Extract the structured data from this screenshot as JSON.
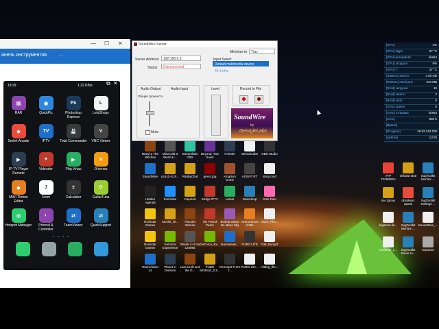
{
  "left_window": {
    "toolbar_label": "анель инструментов",
    "toolbar_dots": "...",
    "minimize": "—",
    "maximize": "☐",
    "close": "✕"
  },
  "phone": {
    "time": "18:29",
    "speed": "1.22 KB/s",
    "apps": [
      {
        "label": "RAR",
        "color": "#8e44ad",
        "glyph": "▤"
      },
      {
        "label": "QuickPic",
        "color": "#2e86de",
        "glyph": "◉"
      },
      {
        "label": "Photoshop Express",
        "color": "#1b3a5c",
        "glyph": "Ps"
      },
      {
        "label": "LetyShops",
        "color": "#f5f5f5",
        "glyph": "L"
      },
      {
        "label": "Smilet Arcade",
        "color": "#e74c3c",
        "glyph": "◈"
      },
      {
        "label": "IPTV",
        "color": "#1e6fc7",
        "glyph": "TV"
      },
      {
        "label": "Total Commander",
        "color": "#3a3a3a",
        "glyph": "💾"
      },
      {
        "label": "VNC Viewer",
        "color": "#444",
        "glyph": "V"
      },
      {
        "label": "IP-TV Player Remote",
        "color": "#2c3e50",
        "glyph": "▶"
      },
      {
        "label": "Videoder",
        "color": "#c0392b",
        "glyph": "▼"
      },
      {
        "label": "Play Игры",
        "color": "#27ae60",
        "glyph": "▶"
      },
      {
        "label": "Очистка",
        "color": "#f39c12",
        "glyph": "✕"
      },
      {
        "label": "MIUI Theme Editor",
        "color": "#e67e22",
        "glyph": "◆"
      },
      {
        "label": "Joom",
        "color": "#fff",
        "glyph": "J"
      },
      {
        "label": "Calculator",
        "color": "#333",
        "glyph": "±"
      },
      {
        "label": "GuitarTuna",
        "color": "#9acd32",
        "glyph": "G"
      },
      {
        "label": "Hotspot Manager",
        "color": "#2ecc71",
        "glyph": "◎"
      },
      {
        "label": "Prismal & Controller",
        "color": "#8e44ad",
        "glyph": "◐"
      },
      {
        "label": "TeamViewer",
        "color": "#1e6fc7",
        "glyph": "⇄"
      },
      {
        "label": "QuickSupport",
        "color": "#2980b9",
        "glyph": "⇄"
      }
    ],
    "dock": [
      {
        "name": "phone-dock-icon",
        "color": "#2ecc71"
      },
      {
        "name": "contacts-dock-icon",
        "color": "#95a5a6"
      },
      {
        "name": "messages-dock-icon",
        "color": "#27ae60"
      },
      {
        "name": "browser-dock-icon",
        "color": "#3498db"
      }
    ]
  },
  "soundwire": {
    "title": "SoundWire Server",
    "minimize_to": "Minimize to",
    "tray": "Tray",
    "server_address_label": "Server Address:",
    "server_address": "192.168.0.3",
    "status_label": "Status:",
    "status": "Disconnected",
    "input_select_label": "Input Select",
    "input_device": "Default multimedia device",
    "sample_rate": "44.1 kHz",
    "audio_output_label": "Audio Output",
    "audio_input_label": "Audio Input",
    "general_volume_label": "Общая громкость",
    "mute_label": "Mute",
    "level_label": "Level",
    "record_label": "Record to File",
    "logo_line1": "SoundWire",
    "logo_line2": "by",
    "logo_line3": "GeorgieLabs"
  },
  "gauges": [
    {
      "label": "[GPU]",
      "value": "4%"
    },
    {
      "label": "[GPU] Ядро",
      "value": "57 °C"
    },
    {
      "label": "[GPU] интерфейс",
      "value": "obs64"
    },
    {
      "label": "[GPU] загрузка",
      "value": "6%"
    },
    {
      "label": "[GPU] Т",
      "value": "37 °C"
    },
    {
      "label": "[Память] занято",
      "value": "4.06 GB"
    },
    {
      "label": "[Память] свободно",
      "value": "510 MB"
    },
    {
      "label": "[RAM] загрузка",
      "value": "10"
    },
    {
      "label": "[RAM] занято",
      "value": "2"
    },
    {
      "label": "[RAM] своб",
      "value": "0"
    },
    {
      "label": "[Сеть] прием",
      "value": "0"
    },
    {
      "label": "[Сеть] отправка",
      "value": "obs64"
    },
    {
      "label": "[Сеть]",
      "value": "685 К"
    },
    {
      "label": "[Время]",
      "value": ""
    },
    {
      "label": "[IP-адрес]",
      "value": "46.53.243.206"
    },
    {
      "label": "[Uptime]",
      "value": "1d 2h"
    }
  ],
  "desktop_icons": [
    {
      "label": "Brawl 3 The Witches Guid...",
      "color": "#8b4513"
    },
    {
      "label": "Minecraft 3 World Li...",
      "color": "#555"
    },
    {
      "label": "Streamlabs OBS",
      "color": "#31c3a2"
    },
    {
      "label": "Beyond: Two Souls",
      "color": "#663399"
    },
    {
      "label": "Fortnite",
      "color": "#2c3e50"
    },
    {
      "label": "StreamLabs",
      "color": "#f0f0f0"
    },
    {
      "label": "OBS Studio",
      "color": "#333"
    },
    {
      "label": "SoundWire",
      "color": "#1e6fc7"
    },
    {
      "label": "pcsx2-v1.5...",
      "color": "#d4a017"
    },
    {
      "label": "RabbyChat",
      "color": "#d4a017"
    },
    {
      "label": "gree1.jpg",
      "color": "#8b0000"
    },
    {
      "label": "Kingdom Come",
      "color": "#a0522d"
    },
    {
      "label": "AGENT RT",
      "color": "#444"
    },
    {
      "label": "temp.cmd",
      "color": "#f0f0f0"
    },
    {
      "label": "Hidden Agenda",
      "color": "#222"
    },
    {
      "label": "freemake",
      "color": "#1e90ff"
    },
    {
      "label": "Caputed",
      "color": "#d4a017"
    },
    {
      "label": "Zedge IPTV",
      "color": "#c0392b"
    },
    {
      "label": "Lamar",
      "color": "#27ae60"
    },
    {
      "label": "Gameloop",
      "color": "#2980b9"
    },
    {
      "label": "Doki Doki",
      "color": "#ff69b4"
    },
    {
      "label": "Rockstar Games",
      "color": "#f1c40f"
    },
    {
      "label": "Movist_W...",
      "color": "#d4a017"
    },
    {
      "label": "Thunder Wolves",
      "color": "#8b4513"
    },
    {
      "label": "My Friend Pedro",
      "color": "#c0392b"
    },
    {
      "label": "Выбор извол No Mans Sky",
      "color": "#9b59b6"
    },
    {
      "label": "VoxCommon 3.261",
      "color": "#e67e22"
    },
    {
      "label": "Giant_Pho...",
      "color": "#f0f0f0"
    },
    {
      "label": "Rockstar Games Launcher",
      "color": "#f1c40f"
    },
    {
      "label": "GeForce Experience",
      "color": "#76b900"
    },
    {
      "label": "Shank 2.v1.0a 120085",
      "color": "#555"
    },
    {
      "label": "GeForce_Ex...",
      "color": "#76b900"
    },
    {
      "label": "teamviewer...",
      "color": "#1e6fc7"
    },
    {
      "label": "PUBG LITE",
      "color": "#333"
    },
    {
      "label": "Call_Europ2",
      "color": "#f0f0f0"
    },
    {
      "label": "TeamViewer 14",
      "color": "#1e6fc7"
    },
    {
      "label": "Planet in Distress",
      "color": "#2c3e50"
    },
    {
      "label": "Lara Croft and the G...",
      "color": "#8b4513"
    },
    {
      "label": "PUBG MOBILE_0.5...",
      "color": "#d4a017"
    },
    {
      "label": "Remnant From T...",
      "color": "#333"
    },
    {
      "label": "PUBG-Lite...",
      "color": "#f0f0f0"
    },
    {
      "label": "Hitting_the...",
      "color": "#f0f0f0"
    }
  ],
  "right_icons": [
    {
      "label": "УТР ТЕЛЕВОН",
      "color": "#ea4335"
    },
    {
      "label": "Обзоки мои",
      "color": "#d4a017"
    },
    {
      "label": "SugToolkit Monitor ...",
      "color": "#2980b9"
    },
    {
      "label": "пес флэш",
      "color": "#d4a017"
    },
    {
      "label": "obsMusic архив",
      "color": "#e74c3c"
    },
    {
      "label": "SugToolkit Settings ...",
      "color": "#2980b9"
    },
    {
      "label": "bigstock-lik...",
      "color": "#f0f0f0"
    },
    {
      "label": "SugToolkit Monitor ...",
      "color": "#2980b9"
    },
    {
      "label": "SoundWire_...",
      "color": "#f0f0f0"
    },
    {
      "label": "Untitled2_L...",
      "color": "#f0f0f0"
    },
    {
      "label": "SugToolkit Driver In...",
      "color": "#2980b9"
    },
    {
      "label": "Корзина",
      "color": "#aaa"
    }
  ]
}
